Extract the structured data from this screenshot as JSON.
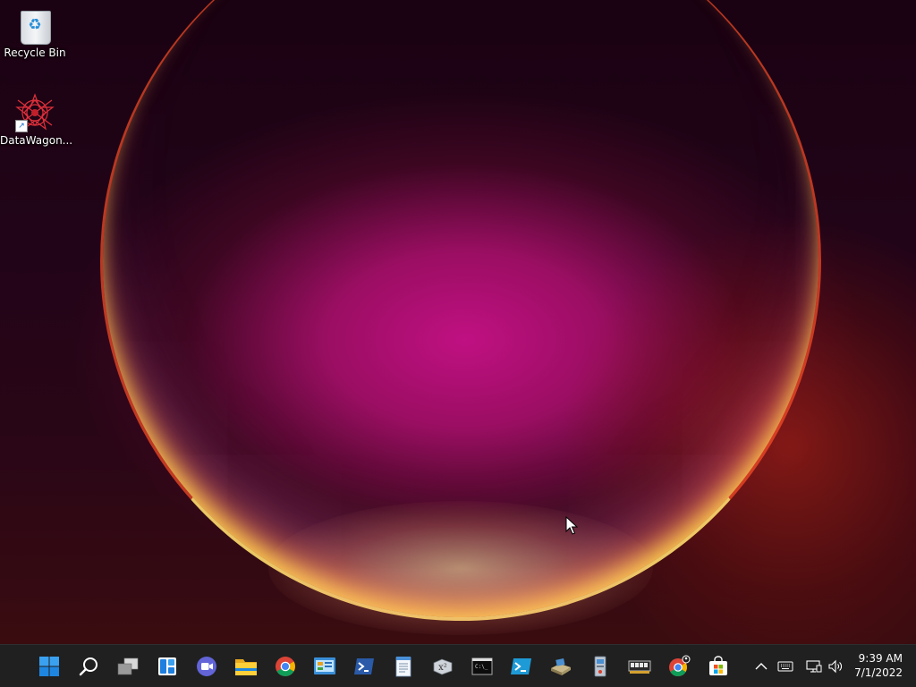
{
  "desktop": {
    "icons": [
      {
        "label": "Recycle Bin",
        "icon": "recycle-bin-icon"
      },
      {
        "label": "DataWagon...",
        "icon": "datawagon-icon"
      }
    ]
  },
  "taskbar": {
    "apps": [
      {
        "name": "start",
        "icon": "windows-start-icon"
      },
      {
        "name": "search",
        "icon": "search-icon"
      },
      {
        "name": "task-view",
        "icon": "task-view-icon"
      },
      {
        "name": "widgets",
        "icon": "widgets-icon"
      },
      {
        "name": "chat",
        "icon": "teams-chat-icon"
      },
      {
        "name": "file-explorer",
        "icon": "folder-icon"
      },
      {
        "name": "chrome",
        "icon": "chrome-icon"
      },
      {
        "name": "control-panel",
        "icon": "control-panel-icon"
      },
      {
        "name": "powershell",
        "icon": "powershell-icon"
      },
      {
        "name": "notepad",
        "icon": "notepad-icon"
      },
      {
        "name": "math-input",
        "icon": "math-icon"
      },
      {
        "name": "command-prompt",
        "icon": "cmd-icon"
      },
      {
        "name": "powershell-ise",
        "icon": "powershell-ise-icon"
      },
      {
        "name": "drive-tool",
        "icon": "drive-icon"
      },
      {
        "name": "registry-tool",
        "icon": "registry-icon"
      },
      {
        "name": "memory-tool",
        "icon": "memory-chip-icon"
      },
      {
        "name": "chrome-profile",
        "icon": "chrome-profile-icon"
      },
      {
        "name": "store",
        "icon": "store-icon"
      }
    ],
    "tray": {
      "icons": [
        "chevron-up-icon",
        "keyboard-icon",
        "network-icon",
        "volume-icon"
      ],
      "time": "9:39 AM",
      "date": "7/1/2022"
    }
  },
  "colors": {
    "taskbar_bg": "#202020",
    "accent": "#0078d4"
  }
}
